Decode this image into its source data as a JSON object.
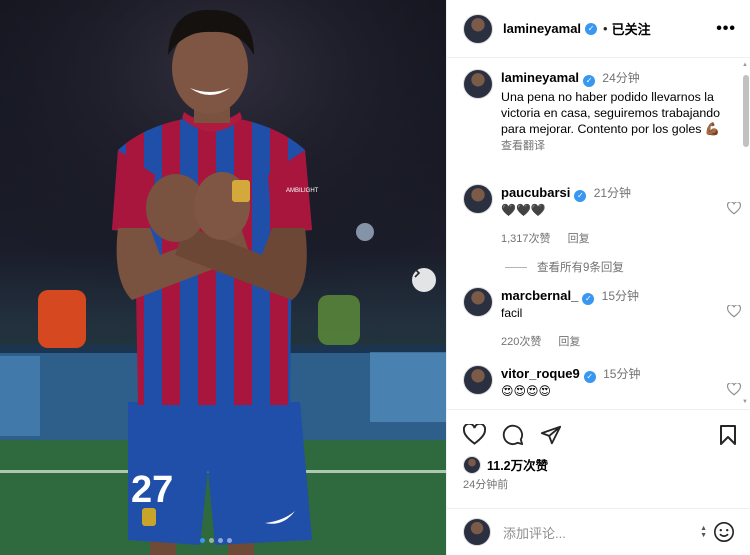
{
  "post": {
    "author": "lamineyamal",
    "follow_status": "已关注",
    "more": "•••",
    "caption": {
      "author": "lamineyamal",
      "time": "24分钟",
      "text": "Una pena no haber podido llevarnos la victoria en casa, seguiremos trabajando para mejorar. Contento por los goles 💪🏾",
      "translate": "查看翻译"
    },
    "comments": [
      {
        "author": "paucubarsi",
        "time": "21分钟",
        "text": "🖤🖤🖤",
        "likes": "1,317次赞",
        "reply": "回复"
      },
      {
        "author": "marcbernal_",
        "time": "15分钟",
        "text": "facil",
        "likes": "220次赞",
        "reply": "回复"
      },
      {
        "author": "vitor_roque9",
        "time": "15分钟",
        "text": "😍😍😍😍",
        "likes": "",
        "reply": ""
      }
    ],
    "view_replies": "查看所有9条回复",
    "likes_count": "11.2万次赞",
    "posted_ago": "24分钟前",
    "add_comment_placeholder": "添加评论...",
    "jersey_number": "27",
    "sponsor": "AMBILIGHT"
  },
  "carousel": {
    "dots": 4,
    "active_index": 0
  },
  "colors": {
    "verified": "#3897f0",
    "muted": "#737373",
    "blaugrana_blue": "#1f4fa8",
    "blaugrana_red": "#a8163e"
  }
}
